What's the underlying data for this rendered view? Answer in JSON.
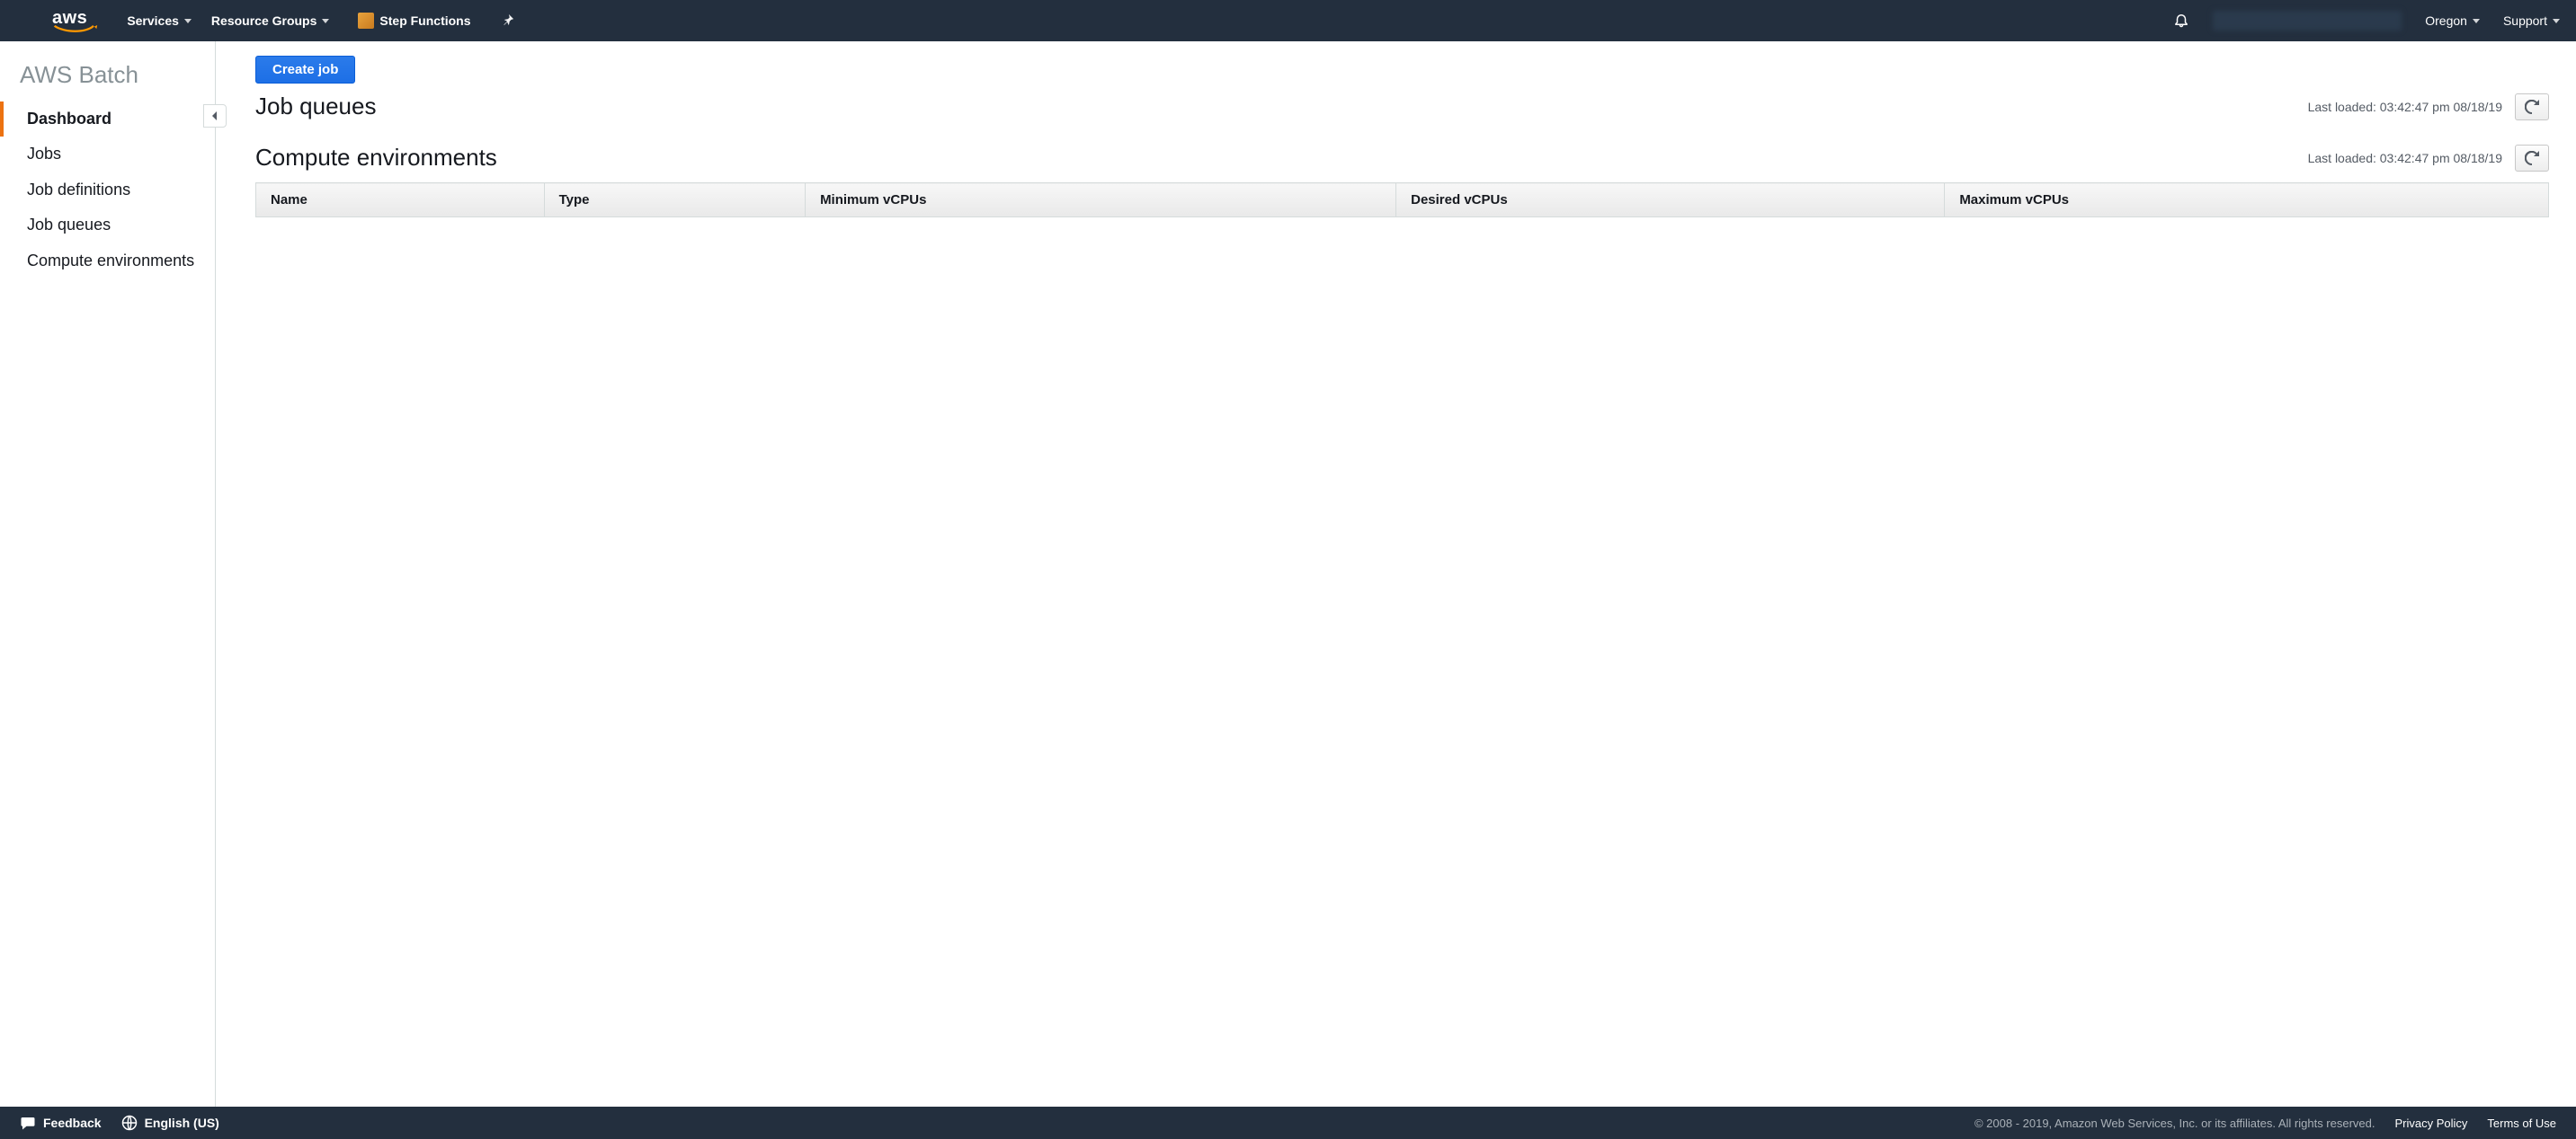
{
  "topnav": {
    "logo_text": "aws",
    "services_label": "Services",
    "resource_groups_label": "Resource Groups",
    "pinned_service_label": "Step Functions",
    "region_label": "Oregon",
    "support_label": "Support"
  },
  "sidebar": {
    "service_title": "AWS Batch",
    "items": [
      {
        "label": "Dashboard",
        "active": true
      },
      {
        "label": "Jobs",
        "active": false
      },
      {
        "label": "Job definitions",
        "active": false
      },
      {
        "label": "Job queues",
        "active": false
      },
      {
        "label": "Compute environments",
        "active": false
      }
    ]
  },
  "main": {
    "create_job_label": "Create job",
    "job_queues": {
      "title": "Job queues",
      "last_loaded_prefix": "Last loaded: ",
      "last_loaded_value": "03:42:47 pm 08/18/19"
    },
    "compute_environments": {
      "title": "Compute environments",
      "last_loaded_prefix": "Last loaded: ",
      "last_loaded_value": "03:42:47 pm 08/18/19",
      "columns": [
        "Name",
        "Type",
        "Minimum vCPUs",
        "Desired vCPUs",
        "Maximum vCPUs"
      ]
    }
  },
  "footer": {
    "feedback_label": "Feedback",
    "language_label": "English (US)",
    "copyright": "© 2008 - 2019, Amazon Web Services, Inc. or its affiliates. All rights reserved.",
    "privacy_label": "Privacy Policy",
    "terms_label": "Terms of Use"
  }
}
